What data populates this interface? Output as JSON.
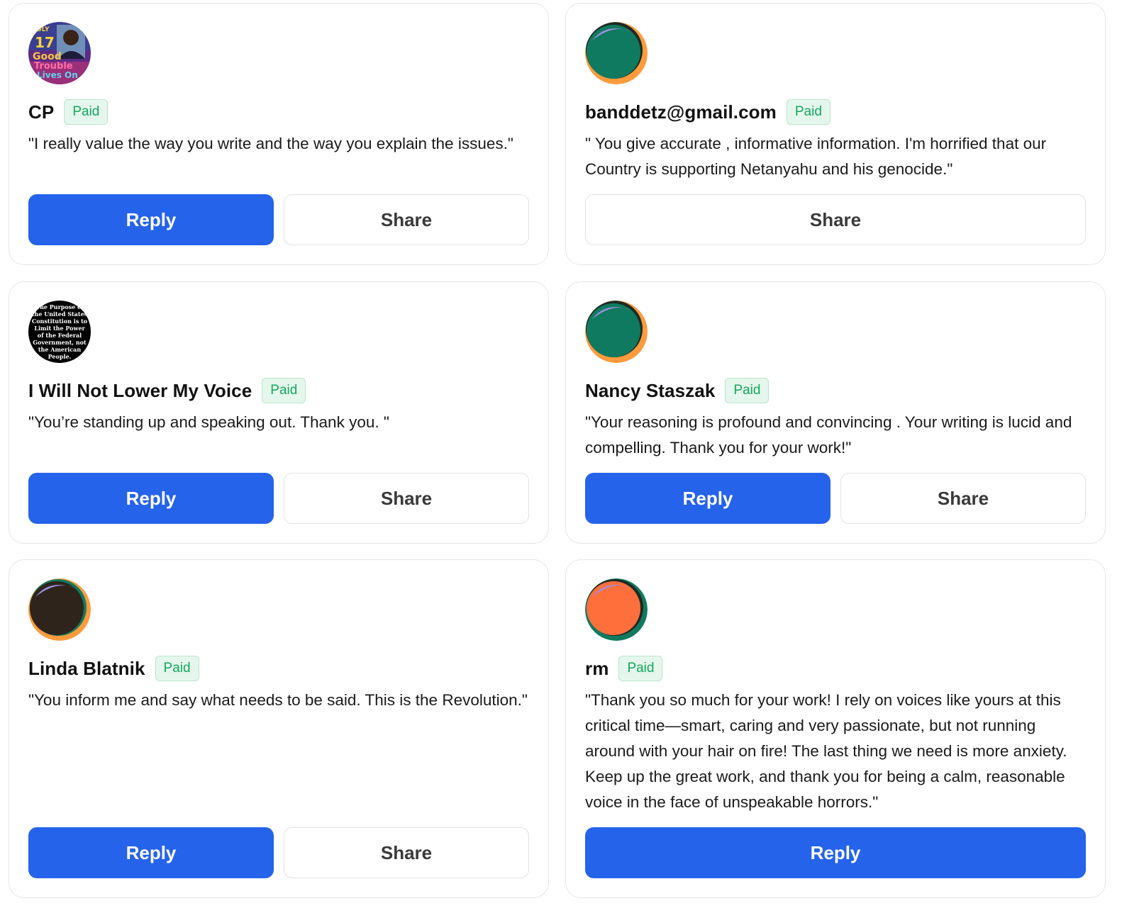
{
  "colors": {
    "reply_button": "#2563eb",
    "paid_badge_text": "#13a85c",
    "paid_badge_bg": "#e5f7ec"
  },
  "cards": [
    {
      "name": "CP",
      "badge": "Paid",
      "quote": "\"I really value the way you write and the way you explain the issues.\"",
      "avatar": "photo-avatar-good-trouble",
      "avatar_text": [
        "JULY",
        "17",
        "Good",
        "Trouble",
        "Lives On"
      ],
      "reply_label": "Reply",
      "share_label": "Share"
    },
    {
      "name": "banddetz@gmail.com",
      "badge": "Paid",
      "quote": "\" You give accurate , informative information. I'm horrified that our Country is supporting Netanyahu and his genocide.\"",
      "avatar": "default-avatar-green",
      "share_label": "Share"
    },
    {
      "name": "I Will Not Lower My Voice",
      "badge": "Paid",
      "quote": "\"You’re standing up and speaking out. Thank you. \"",
      "avatar": "text-avatar-constitution",
      "avatar_text": [
        "The Purpose of",
        "the United States",
        "Constitution is to",
        "Limit the Power",
        "of the Federal",
        "Government, not",
        "the American",
        "People."
      ],
      "reply_label": "Reply",
      "share_label": "Share"
    },
    {
      "name": "Nancy Staszak",
      "badge": "Paid",
      "quote": "\"Your reasoning is profound and convincing . Your writing is lucid and compelling. Thank you for your work!\"",
      "avatar": "default-avatar-green",
      "reply_label": "Reply",
      "share_label": "Share"
    },
    {
      "name": "Linda Blatnik",
      "badge": "Paid",
      "quote": "\"You inform me and say what needs to be said. This is the Revolution.\"",
      "avatar": "default-avatar-dark",
      "reply_label": "Reply",
      "share_label": "Share"
    },
    {
      "name": "rm",
      "badge": "Paid",
      "quote": "\"Thank you so much for your work! I rely on voices like yours at this critical time—smart, caring and very passionate, but not running around with your hair on fire! The last thing we need is more anxiety. Keep up the great work, and thank you for being a calm, reasonable voice in the face of unspeakable horrors.\"",
      "avatar": "default-avatar-orange",
      "reply_label": "Reply"
    }
  ]
}
